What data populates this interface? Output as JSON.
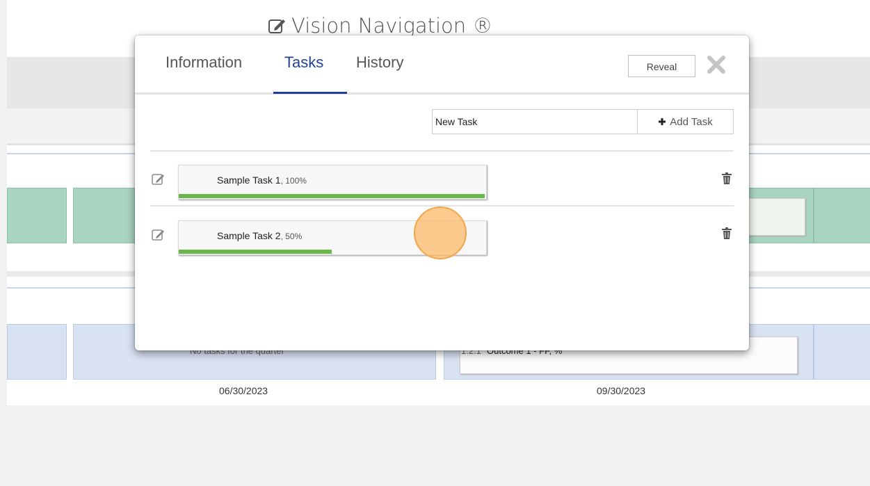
{
  "app": {
    "title": "Vision Navigation ®",
    "title_icon": "edit-icon",
    "dates": [
      "06/30/2023",
      "09/30/2023"
    ],
    "faint_texts": [
      "No tasks for the quarter",
      "1.2.1",
      "Outcome 1 - FF, %"
    ]
  },
  "modal": {
    "tabs": [
      {
        "label": "Information",
        "active": false
      },
      {
        "label": "Tasks",
        "active": true
      },
      {
        "label": "History",
        "active": false
      }
    ],
    "reveal_label": "Reveal",
    "close_icon": "close-icon",
    "new_task": {
      "value": "New Task",
      "placeholder": "New Task"
    },
    "add_task_label": "Add Task",
    "add_task_icon": "plus-icon",
    "tasks": [
      {
        "name": "Sample Task 1",
        "percent_label": ", 100%",
        "progress": 1.0
      },
      {
        "name": "Sample Task 2",
        "percent_label": ", 50%",
        "progress": 0.5
      }
    ]
  },
  "colors": {
    "accent": "#223f9b",
    "progress": "#67b847",
    "green_card": "#a9d4c0",
    "blue_card": "#d9e2f3",
    "click_marker": "#fcba68"
  }
}
